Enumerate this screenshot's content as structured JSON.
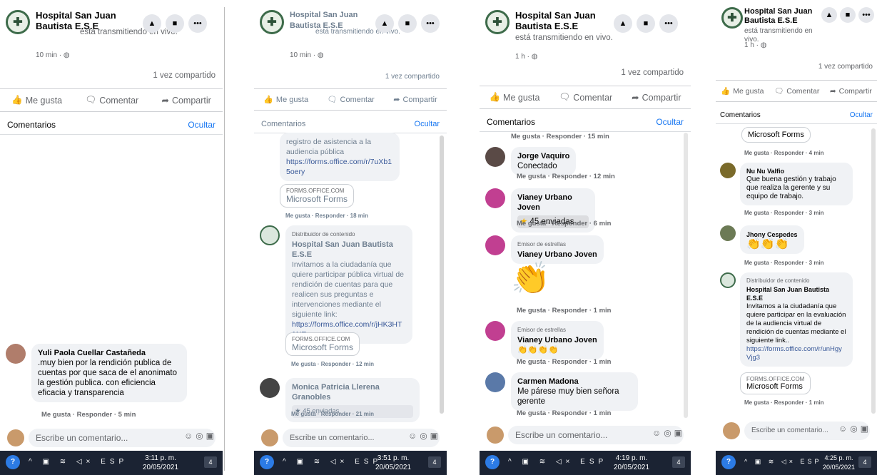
{
  "post": {
    "page_name": "Hospital San Juan Bautista E.S.E",
    "status": "está transmitiendo en vivo.",
    "shared": "1 vez compartido",
    "actions": {
      "like": "Me gusta",
      "comment": "Comentar",
      "share": "Compartir"
    },
    "comments_header": "Comentarios",
    "hide": "Ocultar",
    "composer_placeholder": "Escribe un comentario...",
    "reply_meta_like": "Me gusta",
    "reply_meta_reply": "Responder"
  },
  "panels": [
    {
      "time_ago": "10 min",
      "comments": [
        {
          "name": "Yuli Paola Cuellar Castañeda",
          "text": ".muy bien por la rendición publica de cuentas por que saca de el anonimato la gestión publica. con eficiencia eficacia y transparencia",
          "meta": "Me gusta · Responder · 5 min"
        }
      ],
      "taskbar": {
        "lang": "ESP",
        "time": "3:11 p. m.",
        "date": "20/05/2021",
        "notif": "4"
      }
    },
    {
      "time_ago": "10 min",
      "comments": [
        {
          "text": "registro de asistencia a la audiencia pública",
          "link": "https://forms.office.com/r/7uXb15oery"
        },
        {
          "domain": "FORMS.OFFICE.COM",
          "card": "Microsoft Forms",
          "meta": "Me gusta · Responder · 18 min"
        },
        {
          "badge": "Distribuidor de contenido",
          "name": "Hospital San Juan Bautista E.S.E",
          "text": "Invitamos a la ciudadanía que quiere participar pública virtual de rendición de cuentas para que realicen sus preguntas e intervenciones mediante el siguiente link:",
          "link": "https://forms.office.com/r/jHK3HT1NE",
          "domain": "FORMS.OFFICE.COM",
          "card": "Microsoft Forms",
          "meta": "Me gusta · Responder · 12 min"
        },
        {
          "name": "Monica Patricia Llerena Granobles",
          "stars": "45 enviadas",
          "meta": "Me gusta · Responder · 21 min"
        }
      ],
      "taskbar": {
        "lang": "ESP",
        "time": "3:51 p. m.",
        "date": "20/05/2021",
        "notif": "4"
      }
    },
    {
      "time_ago": "1 h",
      "comments": [
        {
          "meta": "Me gusta · Responder · 15 min"
        },
        {
          "name": "Jorge Vaquiro",
          "text": "Conectado",
          "meta": "Me gusta · Responder · 12 min"
        },
        {
          "name": "Vianey Urbano Joven",
          "stars": "45 enviadas",
          "meta": "Me gusta · Responder · 6 min"
        },
        {
          "badge": "Emisor de estrellas",
          "name": "Vianey Urbano Joven",
          "sticker": "👏",
          "meta": "Me gusta · Responder · 1 min"
        },
        {
          "badge": "Emisor de estrellas",
          "name": "Vianey Urbano Joven",
          "emoji": "👏👏👏👏",
          "meta": "Me gusta · Responder · 1 min"
        },
        {
          "name": "Carmen Madona",
          "text": "Me párese muy bien señora gerente",
          "meta": "Me gusta · Responder · 1 min"
        }
      ],
      "taskbar": {
        "lang": "ESP",
        "time": "4:19 p. m.",
        "date": "20/05/2021",
        "notif": "4"
      }
    },
    {
      "time_ago": "1 h",
      "comments": [
        {
          "card": "Microsoft Forms",
          "meta": "Me gusta · Responder · 4 min"
        },
        {
          "name": "Nu Nu Valfio",
          "text": "Que buena gestión y trabajo que realiza la gerente y su equipo de trabajo.",
          "meta": "Me gusta · Responder · 3 min"
        },
        {
          "name": "Jhony Cespedes",
          "emoji": "👏👏👏",
          "meta": "Me gusta · Responder · 3 min"
        },
        {
          "badge": "Distribuidor de contenido",
          "name": "Hospital San Juan Bautista E.S.E",
          "text": "Invitamos a la ciudadanía que quiere participar en la evaluación de la audiencia virtual de rendición de cuentas mediante el siguiente link..",
          "link": "https://forms.office.com/r/unHgyVjg3",
          "domain": "FORMS.OFFICE.COM",
          "card": "Microsoft Forms",
          "meta": "Me gusta · Responder · 1 min"
        }
      ],
      "taskbar": {
        "lang": "ESP",
        "time": "4:25 p. m.",
        "date": "20/05/2021",
        "notif": "4"
      }
    }
  ]
}
